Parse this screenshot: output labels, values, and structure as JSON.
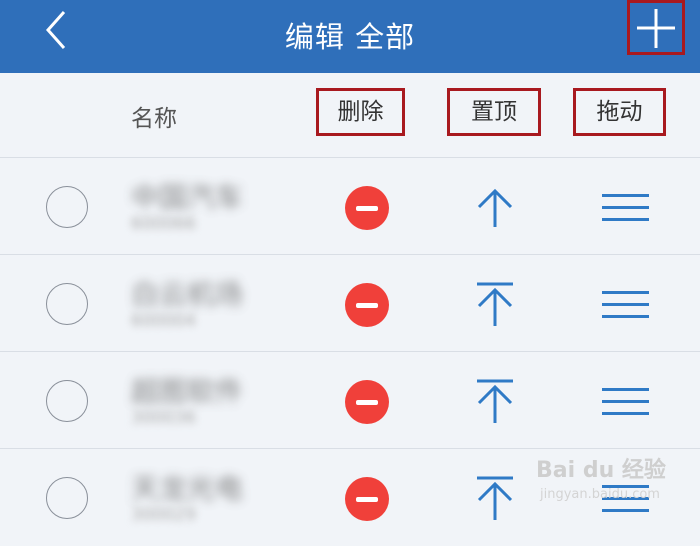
{
  "header": {
    "title": "编辑 全部",
    "back_icon": "chevron-left-icon",
    "add_icon": "plus-icon",
    "bg_color": "#2f6fba"
  },
  "columns": {
    "name": "名称",
    "delete": "删除",
    "pin": "置顶",
    "drag": "拖动"
  },
  "rows": [
    {
      "name": "中国汽车",
      "code": "600066"
    },
    {
      "name": "白云机场",
      "code": "600004"
    },
    {
      "name": "超图软件",
      "code": "300036"
    },
    {
      "name": "天龙光电",
      "code": "300029"
    }
  ],
  "watermark": {
    "brand": "Bai du 经验",
    "url": "jingyan.baidu.com"
  },
  "colors": {
    "accent": "#2f7ac6",
    "delete": "#f0403a",
    "highlight": "#a8191f"
  }
}
